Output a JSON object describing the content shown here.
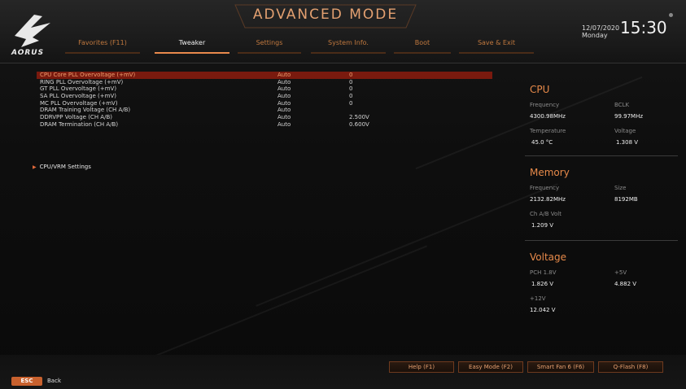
{
  "header": {
    "brand": "AORUS",
    "mode_title": "ADVANCED MODE",
    "date": "12/07/2020",
    "day": "Monday",
    "time": "15:30",
    "tabs": [
      {
        "label": "Favorites (F11)",
        "active": false
      },
      {
        "label": "Tweaker",
        "active": true
      },
      {
        "label": "Settings",
        "active": false
      },
      {
        "label": "System Info.",
        "active": false
      },
      {
        "label": "Boot",
        "active": false
      },
      {
        "label": "Save & Exit",
        "active": false
      }
    ]
  },
  "settings": [
    {
      "name": "CPU Core PLL Overvoltage (+mV)",
      "mode": "Auto",
      "value": "0",
      "selected": true
    },
    {
      "name": "RING PLL Overvoltage (+mV)",
      "mode": "Auto",
      "value": "0",
      "selected": false
    },
    {
      "name": "GT PLL Overvoltage (+mV)",
      "mode": "Auto",
      "value": "0",
      "selected": false
    },
    {
      "name": "SA PLL Overvoltage (+mV)",
      "mode": "Auto",
      "value": "0",
      "selected": false
    },
    {
      "name": "MC PLL Overvoltage (+mV)",
      "mode": "Auto",
      "value": "0",
      "selected": false
    },
    {
      "name": "DRAM Training Voltage     (CH A/B)",
      "mode": "Auto",
      "value": "",
      "selected": false
    },
    {
      "name": "DDRVPP Voltage   (CH A/B)",
      "mode": "Auto",
      "value": "2.500V",
      "selected": false
    },
    {
      "name": "DRAM Termination  (CH A/B)",
      "mode": "Auto",
      "value": "0.600V",
      "selected": false
    }
  ],
  "submenu": {
    "label": "CPU/VRM Settings"
  },
  "panel": {
    "cpu": {
      "title": "CPU",
      "frequency_label": "Frequency",
      "frequency": "4300.98MHz",
      "bclk_label": "BCLK",
      "bclk": "99.97MHz",
      "temperature_label": "Temperature",
      "temperature": "45.0 °C",
      "voltage_label": "Voltage",
      "voltage": "1.308 V"
    },
    "memory": {
      "title": "Memory",
      "frequency_label": "Frequency",
      "frequency": "2132.82MHz",
      "size_label": "Size",
      "size": "8192MB",
      "chab_label": "Ch A/B Volt",
      "chab": "1.209 V"
    },
    "voltage": {
      "title": "Voltage",
      "pch_label": "PCH 1.8V",
      "pch": "1.826 V",
      "p5_label": "+5V",
      "p5": "4.882 V",
      "p12_label": "+12V",
      "p12": "12.042 V"
    }
  },
  "footer": {
    "buttons": [
      {
        "label": "Help (F1)"
      },
      {
        "label": "Easy Mode (F2)"
      },
      {
        "label": "Smart Fan 6 (F6)"
      },
      {
        "label": "Q-Flash (F8)"
      }
    ],
    "esc_label": "ESC",
    "back_label": "Back"
  },
  "colors": {
    "accent": "#e8894c",
    "selected_row": "#7a1a0e",
    "background": "#0b0b0b"
  }
}
